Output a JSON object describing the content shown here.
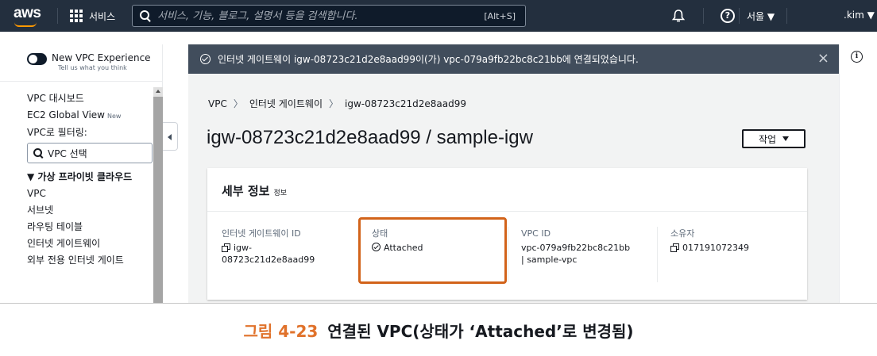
{
  "topnav": {
    "logo": "aws",
    "services_label": "서비스",
    "search_placeholder": "서비스, 기능, 블로그, 설명서 등을 검색합니다.",
    "search_shortcut": "[Alt+S]",
    "help_symbol": "?",
    "region": "서울 ▼",
    "user": ".kim ▼"
  },
  "sidebar": {
    "toggle_title": "New VPC Experience",
    "toggle_sub": "Tell us what you think",
    "dashboard": "VPC 대시보드",
    "ec2_global_view": "EC2 Global View",
    "new_badge": "New",
    "filter_label": "VPC로 필터링:",
    "vpc_select": "VPC 선택",
    "section_title": "▼ 가상 프라이빗 클라우드",
    "items": [
      "VPC",
      "서브넷",
      "라우팅 테이블",
      "인터넷 게이트웨이",
      "외부 전용 인터넷 게이트"
    ]
  },
  "flash": {
    "message": "인터넷 게이트웨이 igw-08723c21d2e8aad99이(가) vpc-079a9fb22bc8c21bb에 연결되었습니다.",
    "close": "×"
  },
  "info_symbol": "i",
  "breadcrumb": [
    "VPC",
    "인터넷 게이트웨이",
    "igw-08723c21d2e8aad99"
  ],
  "breadcrumb_sep": "〉",
  "page_title": "igw-08723c21d2e8aad99 / sample-igw",
  "actions_label": "작업",
  "details": {
    "title": "세부 정보",
    "info_link": "정보",
    "igw_id_label": "인터넷 게이트웨이 ID",
    "igw_id_line1": "igw-",
    "igw_id_line2": "08723c21d2e8aad99",
    "state_label": "상태",
    "state_value": "Attached",
    "vpc_id_label": "VPC ID",
    "vpc_id_line1": "vpc-079a9fb22bc8c21bb",
    "vpc_id_line2": "| sample-vpc",
    "owner_label": "소유자",
    "owner_value": "017191072349"
  },
  "caption": {
    "number": "그림 4-23",
    "text": "연결된 VPC(상태가 ‘Attached’로 변경됨)"
  },
  "colors": {
    "nav_bg": "#232f3e",
    "flash_bg": "#414d5c",
    "highlight": "#d2631a",
    "caption_accent": "#e0722b"
  }
}
